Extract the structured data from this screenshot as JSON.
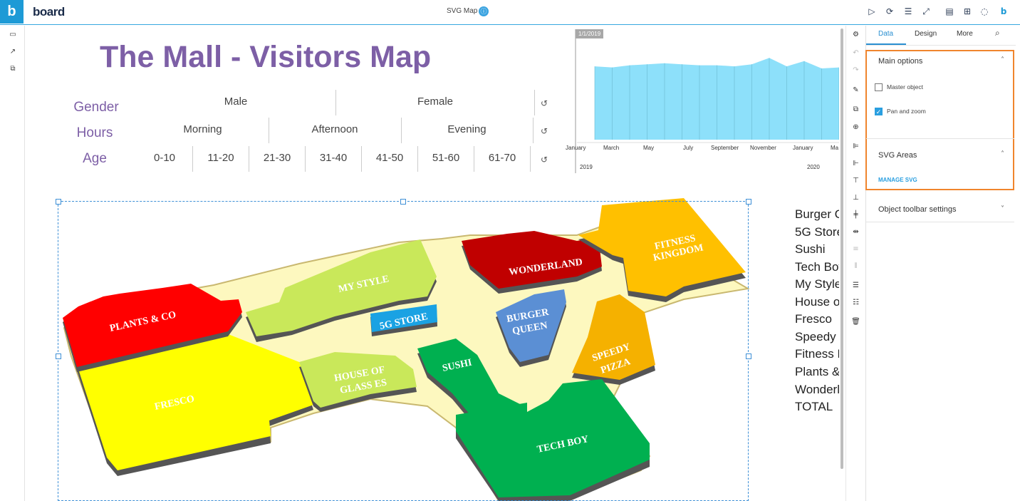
{
  "app": {
    "logo_letter": "b",
    "logo_word": "board"
  },
  "header": {
    "page_name": "SVG Map",
    "badge": "ⓘ"
  },
  "canvas": {
    "title": "The Mall - Visitors Map",
    "selectors": {
      "gender": {
        "label": "Gender",
        "options": [
          "Male",
          "Female"
        ]
      },
      "hours": {
        "label": "Hours",
        "options": [
          "Morning",
          "Afternoon",
          "Evening"
        ]
      },
      "age": {
        "label": "Age",
        "options": [
          "0-10",
          "11-20",
          "21-30",
          "31-40",
          "41-50",
          "51-60",
          "61-70"
        ]
      }
    },
    "legend": [
      "Burger Queen",
      "5G Store",
      "Sushi",
      "Tech Boy",
      "My Style",
      "House of Glasses",
      "Fresco",
      "Speedy",
      "Fitness Kingdom",
      "Plants & Co",
      "Wonderland",
      "TOTAL"
    ]
  },
  "chart_data": {
    "type": "area",
    "date_badge": "1/1/2019",
    "x": [
      "January",
      "March",
      "May",
      "July",
      "September",
      "November",
      "January",
      "Ma"
    ],
    "year_labels": [
      "2019",
      "2020"
    ],
    "values": [
      70,
      69,
      71,
      72,
      73,
      72,
      71,
      71,
      70,
      72,
      78,
      70,
      75,
      68,
      69
    ],
    "ylim": [
      0,
      100
    ],
    "color": "#8de0fa"
  },
  "map": {
    "areas": [
      {
        "name": "PLANTS & CO",
        "color": "#ff0000"
      },
      {
        "name": "FRESCO",
        "color": "#ffff00"
      },
      {
        "name": "MY STYLE",
        "color": "#c9e85a"
      },
      {
        "name": "HOUSE OF GLASSES",
        "line1": "HOUSE OF",
        "line2": "GLASS ES",
        "color": "#c9e85a"
      },
      {
        "name": "5G STORE",
        "color": "#1aa2e3"
      },
      {
        "name": "WONDERLAND",
        "color": "#c00000"
      },
      {
        "name": "FITNESS KINGDOM",
        "line1": "FITNESS",
        "line2": "KINGDOM",
        "color": "#ffc000"
      },
      {
        "name": "BURGER QUEEN",
        "line1": "BURGER",
        "line2": "QUEEN",
        "color": "#5b8fd4"
      },
      {
        "name": "SPEEDY PIZZA",
        "line1": "SPEEDY",
        "line2": "PIZZA",
        "color": "#f5b100"
      },
      {
        "name": "SUSHI",
        "color": "#00b050"
      },
      {
        "name": "TECH BOY",
        "color": "#00b050"
      }
    ],
    "floor_color": "#fdf8bf"
  },
  "panel": {
    "tabs": [
      "Data",
      "Design",
      "More"
    ],
    "active_tab": "Data",
    "sections": {
      "main_options": {
        "title": "Main options",
        "master_object": "Master object",
        "pan_zoom": "Pan and zoom",
        "master_checked": false,
        "pan_checked": true
      },
      "svg_areas": {
        "title": "SVG Areas",
        "manage": "MANAGE SVG"
      },
      "toolbar_settings": {
        "title": "Object toolbar settings"
      }
    }
  },
  "accent_colors": {
    "brand": "#1d9ad6",
    "title_purple": "#7d5fa6",
    "highlight": "#f0852d"
  }
}
